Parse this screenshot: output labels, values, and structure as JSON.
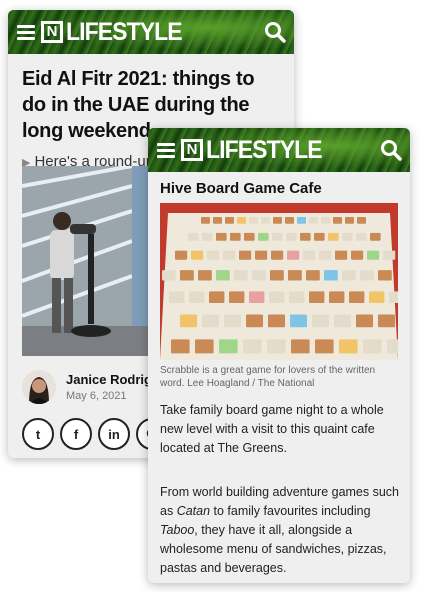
{
  "brand": {
    "logo_letter": "N",
    "logo_text": "LIFESTYLE",
    "header_color": "#2a5d1a"
  },
  "back_article": {
    "title": "Eid Al Fitr 2021: things to do in the UAE during the long weekend",
    "summary": "Here's a round-up of family friendly activities to keep you b",
    "author_name": "Janice Rodrigue",
    "date": "May 6, 2021",
    "share": [
      {
        "icon": "twitter-icon",
        "glyph": "t"
      },
      {
        "icon": "facebook-icon",
        "glyph": "f"
      },
      {
        "icon": "linkedin-icon",
        "glyph": "in"
      },
      {
        "icon": "whatsapp-icon",
        "glyph": "✆"
      }
    ]
  },
  "front_article": {
    "title": "Hive Board Game Cafe",
    "caption": "Scrabble is a great game for lovers of the written word. Lee Hoagland / The National",
    "para1": "Take family board game night to a whole new level with a visit to this quaint cafe located at The Greens.",
    "para2_start": "From world building adventure games such as ",
    "para2_em1": "Catan",
    "para2_mid": " to family favourites including ",
    "para2_em2": "Taboo",
    "para2_end": ", they have it all, alongside a wholesome menu of sandwiches, pizzas, pastas and beverages."
  }
}
